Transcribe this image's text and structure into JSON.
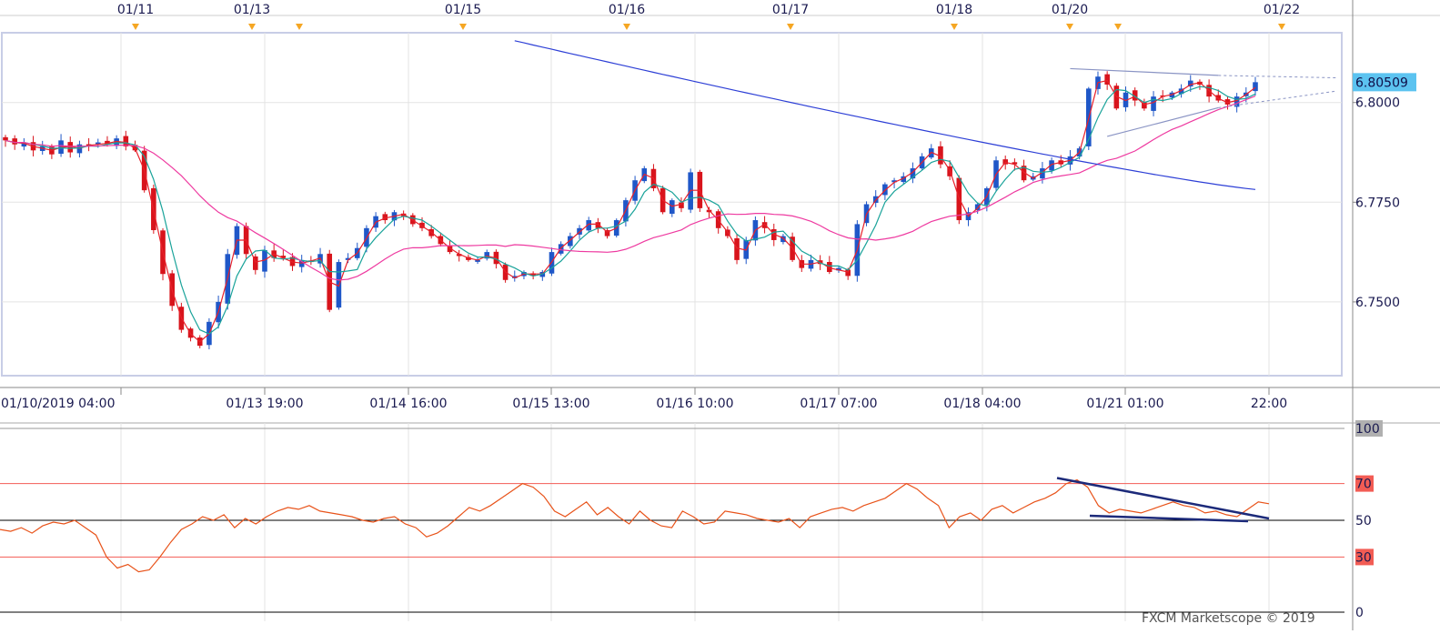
{
  "chart_data": [
    {
      "type": "candlestick",
      "title": "",
      "event_dates": [
        "01/11",
        "01/13",
        "01/15",
        "01/16",
        "01/17",
        "01/18",
        "01/20",
        "01/22"
      ],
      "x_tick_labels": [
        "01/10/2019 04:00",
        "01/13 19:00",
        "01/14 16:00",
        "01/15 13:00",
        "01/16 10:00",
        "01/17 07:00",
        "01/18 04:00",
        "01/21 01:00",
        "22:00"
      ],
      "y_tick_labels": [
        "6.8000",
        "6.7750",
        "6.7500"
      ],
      "ylim": [
        6.7315,
        6.8175
      ],
      "last_price_label": "6.80509",
      "grid": true,
      "colors": {
        "up": "#1f57c8",
        "down": "#d8141c",
        "ma_fast": "#e8202a",
        "ma_mid": "#1aa39a",
        "ma_slow": "#ee3aa0",
        "ma_long": "#2d3fd6",
        "last_price_bg": "#5cc3f0"
      },
      "close": [
        6.7905,
        6.7895,
        6.79,
        6.788,
        6.789,
        6.787,
        6.7905,
        6.7875,
        6.7895,
        6.789,
        6.79,
        6.7895,
        6.791,
        6.789,
        6.788,
        6.778,
        6.768,
        6.757,
        6.749,
        6.743,
        6.741,
        6.739,
        6.745,
        6.75,
        6.762,
        6.769,
        6.762,
        6.758,
        6.763,
        6.761,
        6.761,
        6.759,
        6.7605,
        6.76,
        6.762,
        6.748,
        6.76,
        6.761,
        6.7635,
        6.7685,
        6.7715,
        6.7705,
        6.7725,
        6.7715,
        6.7695,
        6.7685,
        6.7665,
        6.7645,
        6.7625,
        6.7615,
        6.7605,
        6.7605,
        6.7625,
        6.7595,
        6.7555,
        6.7565,
        6.7575,
        6.7565,
        6.7575,
        6.7625,
        6.7645,
        6.7665,
        6.7685,
        6.7705,
        6.7685,
        6.7665,
        6.7705,
        6.7755,
        6.7805,
        6.7835,
        6.7785,
        6.7725,
        6.7755,
        6.7735,
        6.7825,
        6.7735,
        6.7725,
        6.7685,
        6.7665,
        6.7605,
        6.7655,
        6.7705,
        6.7685,
        6.7655,
        6.7665,
        6.7605,
        6.7585,
        6.7605,
        6.7595,
        6.7575,
        6.7585,
        6.7565,
        6.7695,
        6.7745,
        6.7765,
        6.7795,
        6.7805,
        6.7815,
        6.7835,
        6.7865,
        6.7885,
        6.7845,
        6.7815,
        6.7705,
        6.7725,
        6.7745,
        6.7785,
        6.7855,
        6.7845,
        6.7845,
        6.7805,
        6.7815,
        6.7835,
        6.7855,
        6.7845,
        6.7865,
        6.7885,
        6.8035,
        6.8065,
        6.8045,
        6.7985,
        6.8025,
        6.8005,
        6.7985,
        6.8015,
        6.8015,
        6.8025,
        6.8035,
        6.8055,
        6.8045,
        6.8015,
        6.8005,
        6.7995,
        6.8015,
        6.8025,
        6.8051
      ],
      "rsi_panel": {
        "levels": [
          "100",
          "70",
          "50",
          "30",
          "0"
        ],
        "level_colors": {
          "100": "#999999",
          "70": "#f25c54",
          "50": "#000000",
          "30": "#f25c54",
          "0": "#000000"
        },
        "rsi": [
          45,
          44,
          46,
          43,
          47,
          49,
          48,
          50,
          46,
          42,
          30,
          24,
          26,
          22,
          23,
          30,
          38,
          45,
          48,
          52,
          50,
          53,
          46,
          51,
          48,
          52,
          55,
          57,
          56,
          58,
          55,
          54,
          53,
          52,
          50,
          49,
          51,
          52,
          48,
          46,
          41,
          43,
          47,
          52,
          57,
          55,
          58,
          62,
          66,
          70,
          68,
          63,
          55,
          52,
          56,
          60,
          53,
          57,
          52,
          48,
          55,
          50,
          47,
          46,
          55,
          52,
          48,
          49,
          55,
          54,
          53,
          51,
          50,
          49,
          51,
          46,
          52,
          54,
          56,
          57,
          55,
          58,
          60,
          62,
          66,
          70,
          67,
          62,
          58,
          46,
          52,
          54,
          50,
          56,
          58,
          54,
          57,
          60,
          62,
          65,
          70,
          72,
          68,
          58,
          54,
          56,
          55,
          54,
          56,
          58,
          60,
          58,
          57,
          54,
          55,
          53,
          52,
          56,
          60,
          59
        ]
      }
    }
  ],
  "footer": {
    "watermark": "FXCM Marketscope © 2019"
  }
}
